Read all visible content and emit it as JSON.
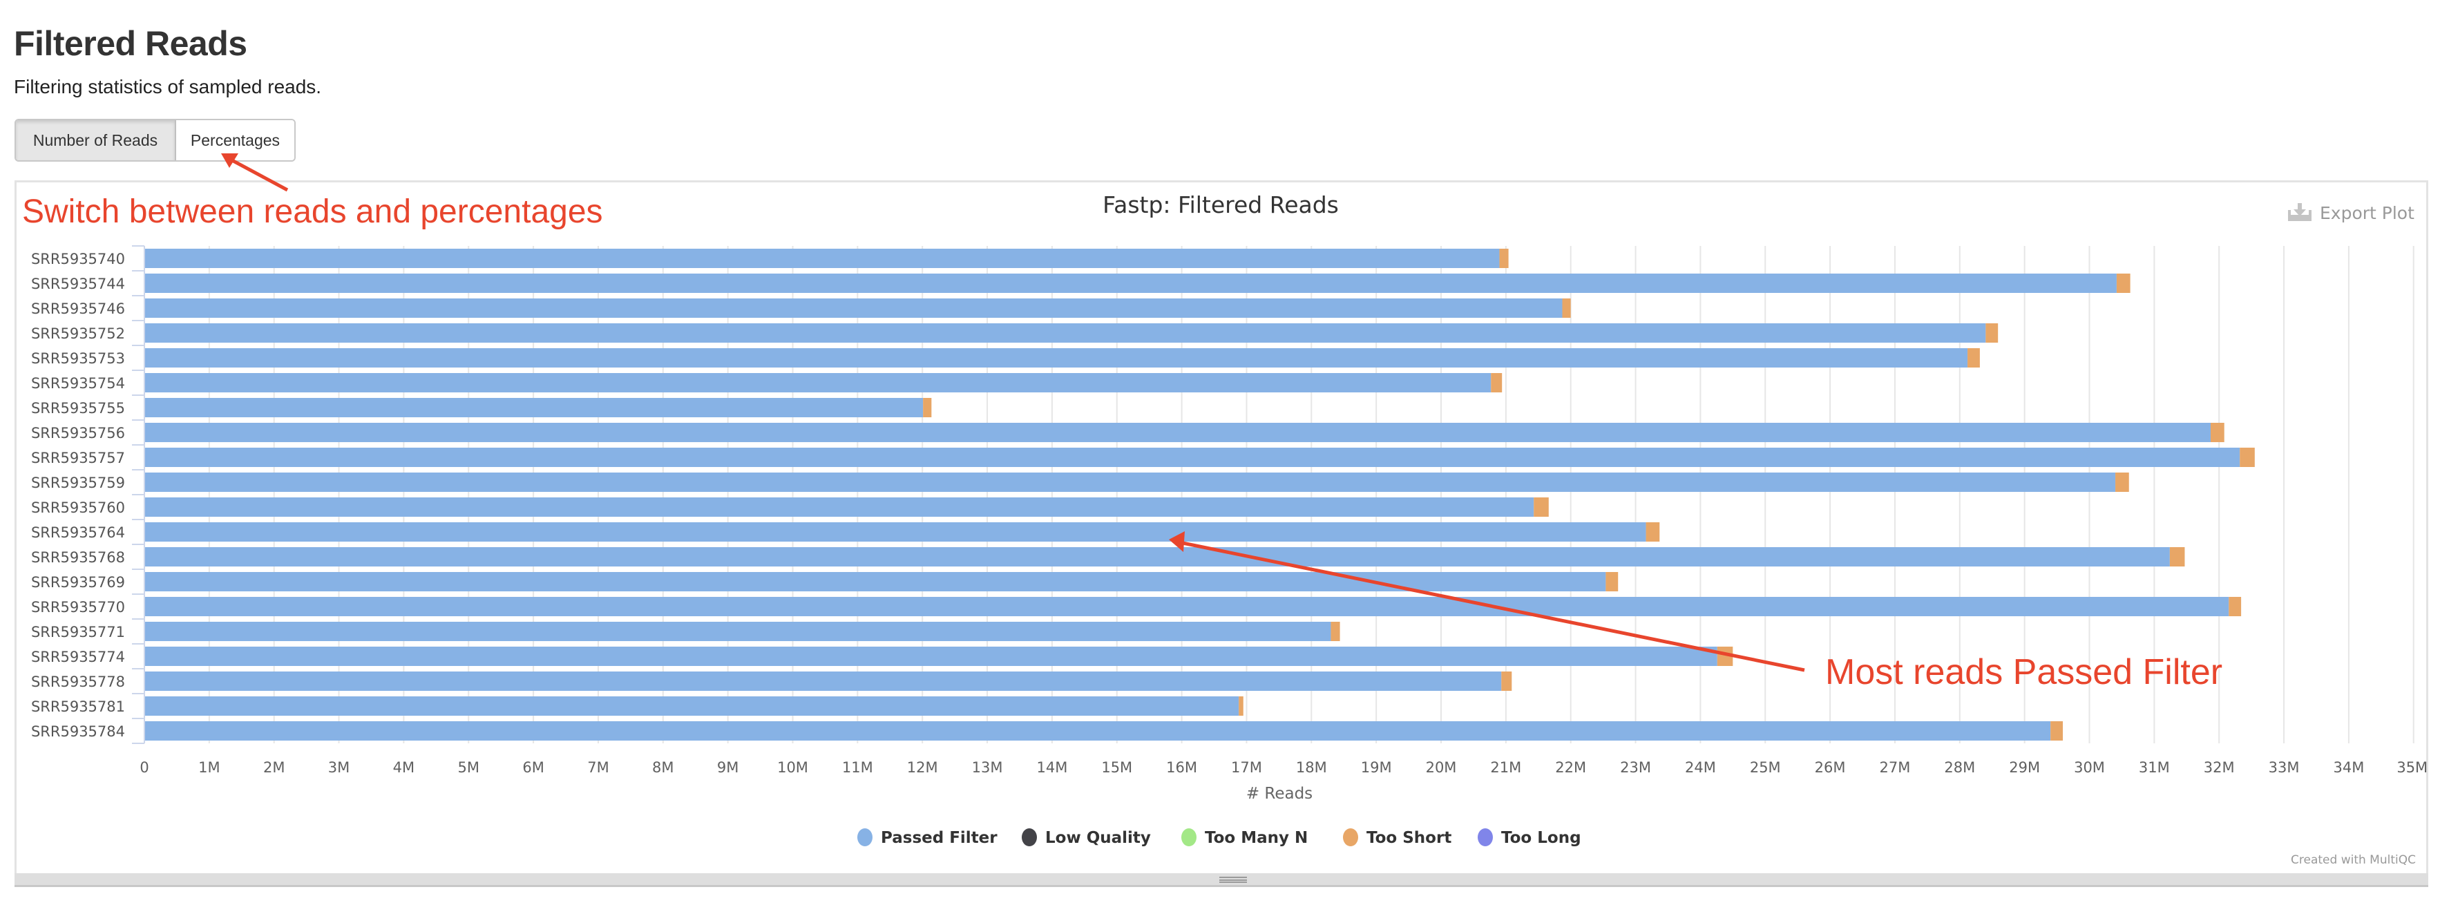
{
  "page": {
    "title": "Filtered Reads",
    "description": "Filtering statistics of sampled reads."
  },
  "toggle": {
    "buttons": [
      {
        "label": "Number of Reads",
        "active": true
      },
      {
        "label": "Percentages",
        "active": false
      }
    ]
  },
  "toolbar": {
    "export_label": "Export Plot",
    "export_icon": "download-icon"
  },
  "credits": "Created with MultiQC",
  "annotations": [
    {
      "text": "Switch between reads and percentages",
      "color": "#e8452d",
      "points_to": "Percentages button"
    },
    {
      "text": "Most reads Passed Filter",
      "color": "#e8452d",
      "points_to": "Passed Filter bars"
    }
  ],
  "chart_data": {
    "type": "bar",
    "orientation": "horizontal",
    "stacked": true,
    "title": "Fastp: Filtered Reads",
    "xlabel": "# Reads",
    "ylabel": "",
    "xlim": [
      0,
      35000000
    ],
    "x_ticks": [
      "0",
      "1M",
      "2M",
      "3M",
      "4M",
      "5M",
      "6M",
      "7M",
      "8M",
      "9M",
      "10M",
      "11M",
      "12M",
      "13M",
      "14M",
      "15M",
      "16M",
      "17M",
      "18M",
      "19M",
      "20M",
      "21M",
      "22M",
      "23M",
      "24M",
      "25M",
      "26M",
      "27M",
      "28M",
      "29M",
      "30M",
      "31M",
      "32M",
      "33M",
      "34M",
      "35M"
    ],
    "grid": true,
    "legend_position": "bottom-center",
    "categories": [
      "SRR5935740",
      "SRR5935744",
      "SRR5935746",
      "SRR5935752",
      "SRR5935753",
      "SRR5935754",
      "SRR5935755",
      "SRR5935756",
      "SRR5935757",
      "SRR5935759",
      "SRR5935760",
      "SRR5935764",
      "SRR5935768",
      "SRR5935769",
      "SRR5935770",
      "SRR5935771",
      "SRR5935774",
      "SRR5935778",
      "SRR5935781",
      "SRR5935784"
    ],
    "series": [
      {
        "name": "Passed Filter",
        "color": "#87b2e5",
        "values": [
          20900000,
          30420000,
          21870000,
          28400000,
          28120000,
          20770000,
          12010000,
          31870000,
          32320000,
          30400000,
          21430000,
          23160000,
          31240000,
          22540000,
          32150000,
          18300000,
          24260000,
          20930000,
          16880000,
          29400000
        ]
      },
      {
        "name": "Low Quality",
        "color": "#434348",
        "values": [
          0,
          0,
          0,
          0,
          0,
          0,
          0,
          0,
          0,
          0,
          0,
          0,
          0,
          0,
          0,
          0,
          0,
          0,
          0,
          0
        ]
      },
      {
        "name": "Too Many N",
        "color": "#a3e887",
        "values": [
          0,
          0,
          0,
          0,
          0,
          0,
          0,
          0,
          0,
          0,
          0,
          0,
          0,
          0,
          0,
          0,
          0,
          0,
          0,
          0
        ]
      },
      {
        "name": "Too Short",
        "color": "#e8a666",
        "values": [
          140000,
          210000,
          130000,
          190000,
          190000,
          170000,
          130000,
          210000,
          230000,
          210000,
          230000,
          210000,
          230000,
          190000,
          190000,
          140000,
          240000,
          160000,
          70000,
          190000
        ]
      },
      {
        "name": "Too Long",
        "color": "#8085e9",
        "values": [
          0,
          0,
          0,
          0,
          0,
          0,
          0,
          0,
          0,
          0,
          0,
          0,
          0,
          0,
          0,
          0,
          0,
          0,
          0,
          0
        ]
      }
    ]
  }
}
